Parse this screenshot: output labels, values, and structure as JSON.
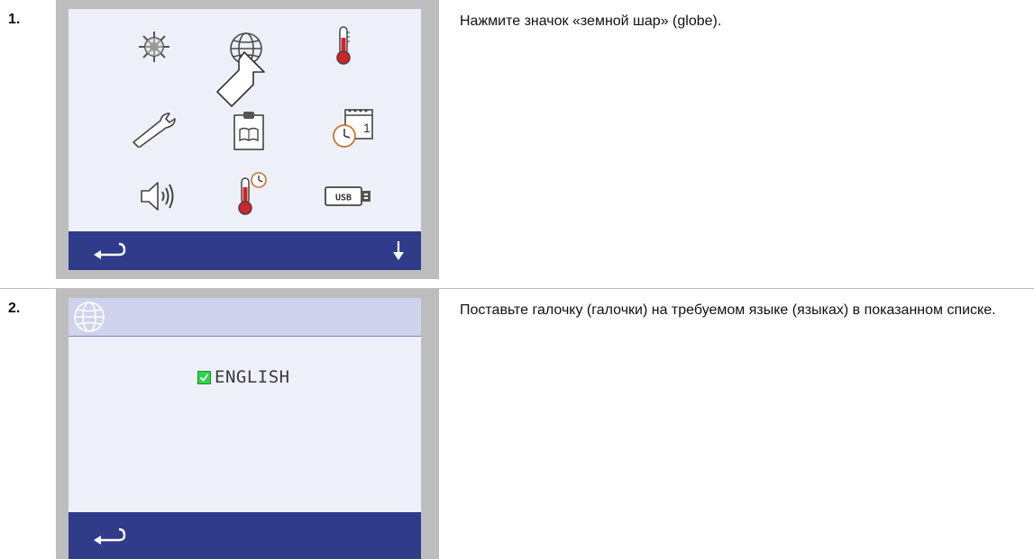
{
  "steps": [
    {
      "number": "1.",
      "text": "Нажмите значок «земной шар» (globe).",
      "screen": {
        "icons": [
          "settings-wheel-icon",
          "globe-icon",
          "thermometer-icon",
          "wrench-icon",
          "clipboard-book-icon",
          "calendar-clock-icon",
          "speaker-icon",
          "thermometer-clock-icon",
          "usb-icon"
        ],
        "usb_label": "USB",
        "calendar_label": "1"
      }
    },
    {
      "number": "2.",
      "text": "Поставьте галочку (галочки) на требуемом языке (языках) в показанном списке.",
      "screen": {
        "languages": [
          {
            "label": "ENGLISH",
            "checked": true
          }
        ]
      }
    }
  ],
  "colors": {
    "nav_bar": "#303c8a",
    "screen_bg": "#eef0f9",
    "header_bg": "#cfd3ec",
    "checkbox": "#2fd24a",
    "thermometer": "#d2232a"
  }
}
